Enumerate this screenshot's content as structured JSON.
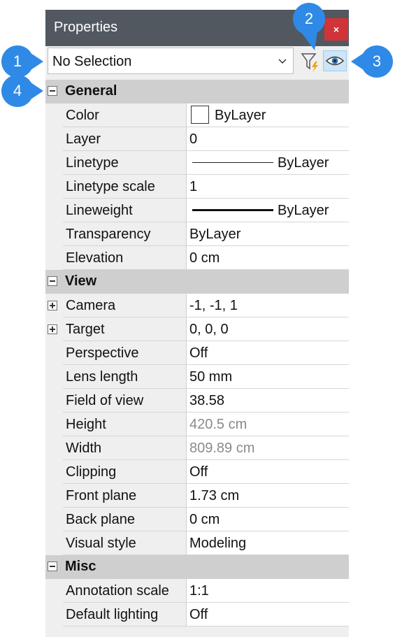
{
  "panel": {
    "title": "Properties",
    "close_label": "×",
    "selection": "No Selection"
  },
  "callouts": [
    "1",
    "2",
    "3",
    "4"
  ],
  "sections": {
    "general": {
      "label": "General",
      "rows": [
        {
          "name": "Color",
          "value": "ByLayer"
        },
        {
          "name": "Layer",
          "value": "0"
        },
        {
          "name": "Linetype",
          "value": "ByLayer"
        },
        {
          "name": "Linetype scale",
          "value": "1"
        },
        {
          "name": "Lineweight",
          "value": "ByLayer"
        },
        {
          "name": "Transparency",
          "value": "ByLayer"
        },
        {
          "name": "Elevation",
          "value": "0 cm"
        }
      ]
    },
    "view": {
      "label": "View",
      "rows": [
        {
          "name": "Camera",
          "value": "-1, -1, 1"
        },
        {
          "name": "Target",
          "value": "0, 0, 0"
        },
        {
          "name": "Perspective",
          "value": "Off"
        },
        {
          "name": "Lens length",
          "value": "50 mm"
        },
        {
          "name": "Field of view",
          "value": "38.58"
        },
        {
          "name": "Height",
          "value": "420.5 cm"
        },
        {
          "name": "Width",
          "value": "809.89 cm"
        },
        {
          "name": "Clipping",
          "value": "Off"
        },
        {
          "name": "Front plane",
          "value": "1.73 cm"
        },
        {
          "name": "Back plane",
          "value": "0 cm"
        },
        {
          "name": "Visual style",
          "value": "Modeling"
        }
      ]
    },
    "misc": {
      "label": "Misc",
      "rows": [
        {
          "name": "Annotation scale",
          "value": "1:1"
        },
        {
          "name": "Default lighting",
          "value": "Off"
        }
      ]
    }
  },
  "colors": {
    "titlebar": "#515860",
    "close": "#d13438",
    "callout": "#2e8ae6",
    "section_header": "#cfcfcf"
  },
  "icons": {
    "filter": "quick-select-filter-icon",
    "eye": "eye-icon",
    "dropdown": "chevron-down-icon"
  }
}
